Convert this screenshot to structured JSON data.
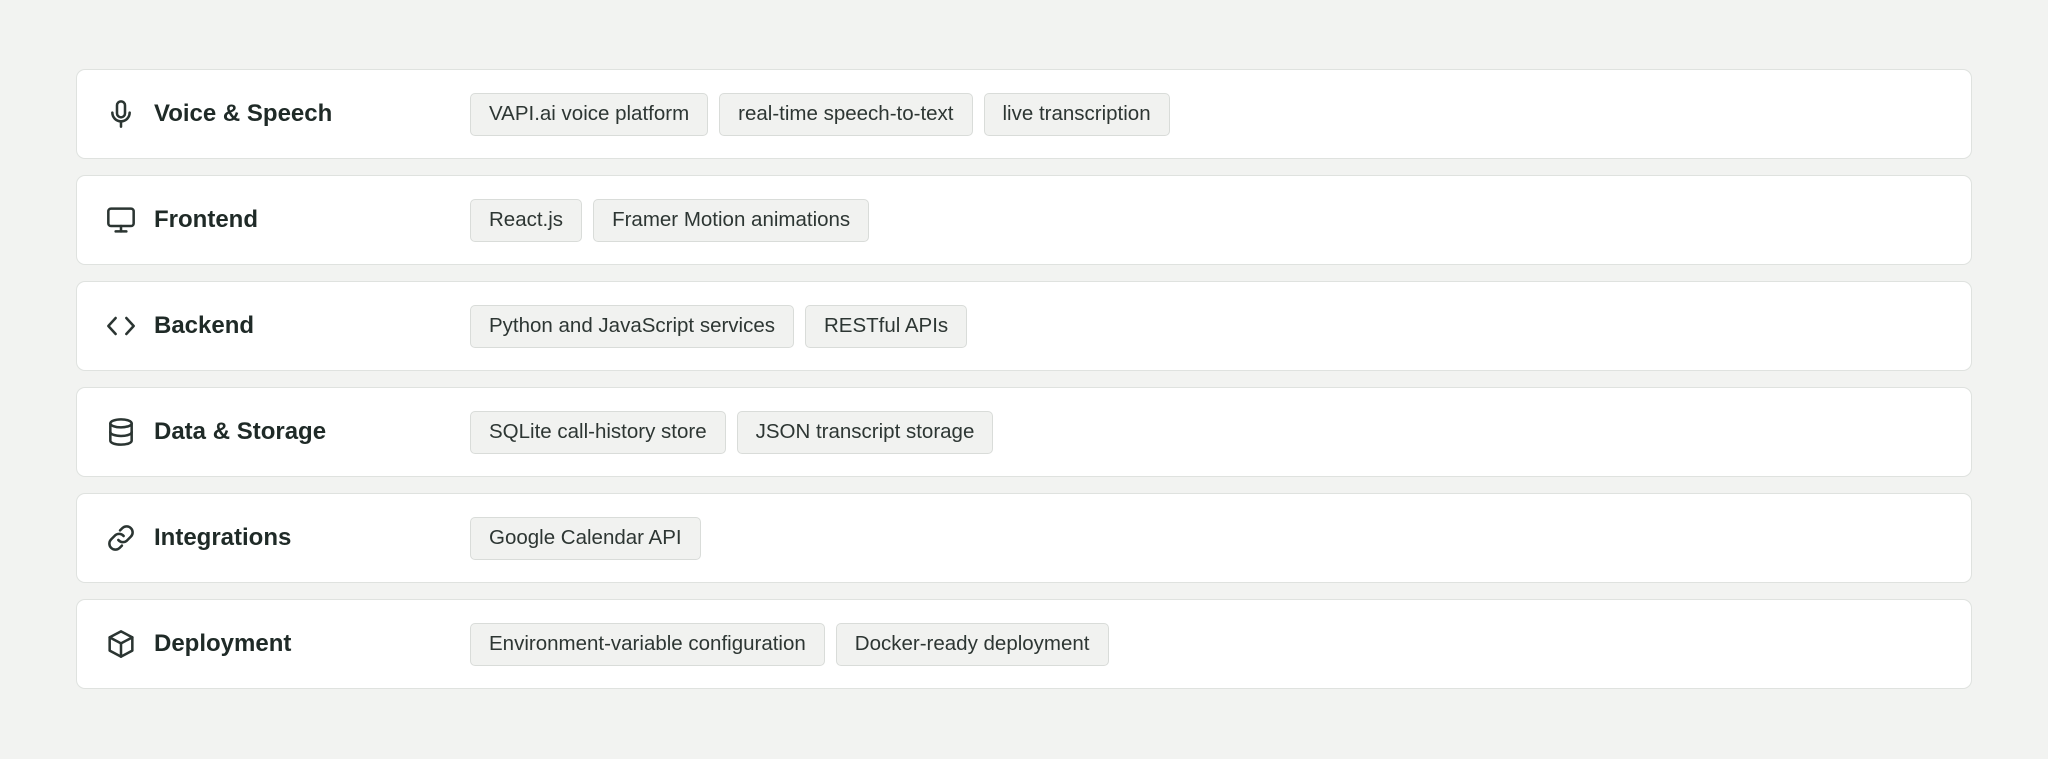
{
  "categories": [
    {
      "icon": "microphone-icon",
      "title": "Voice & Speech",
      "tags": [
        "VAPI.ai voice platform",
        "real-time speech-to-text",
        "live transcription"
      ]
    },
    {
      "icon": "monitor-icon",
      "title": "Frontend",
      "tags": [
        "React.js",
        "Framer Motion animations"
      ]
    },
    {
      "icon": "code-icon",
      "title": "Backend",
      "tags": [
        "Python and JavaScript services",
        "RESTful APIs"
      ]
    },
    {
      "icon": "database-icon",
      "title": "Data & Storage",
      "tags": [
        "SQLite call-history store",
        "JSON transcript storage"
      ]
    },
    {
      "icon": "link-icon",
      "title": "Integrations",
      "tags": [
        "Google Calendar API"
      ]
    },
    {
      "icon": "package-icon",
      "title": "Deployment",
      "tags": [
        "Environment-variable configuration",
        "Docker-ready deployment"
      ]
    }
  ]
}
